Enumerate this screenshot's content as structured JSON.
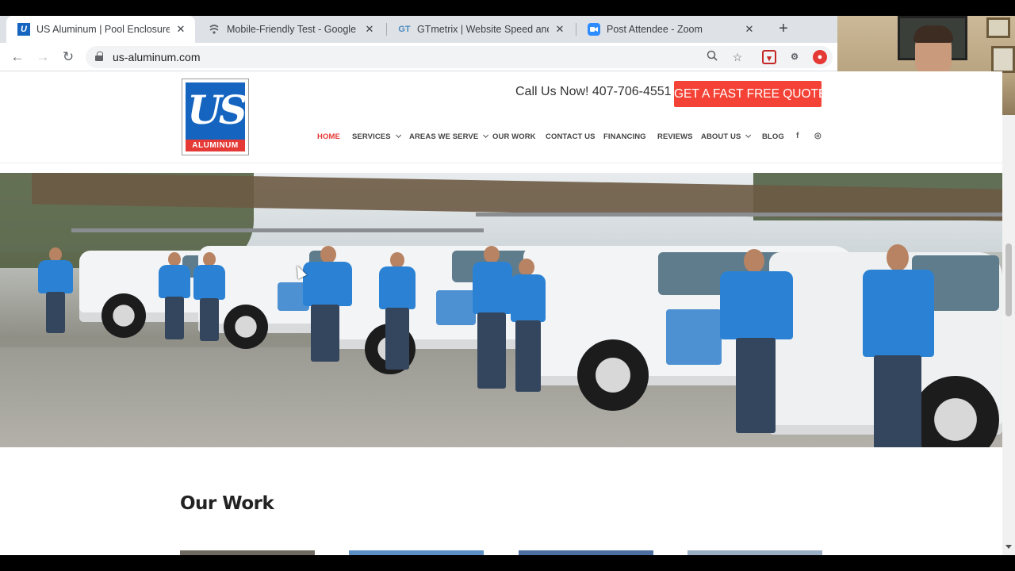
{
  "browser": {
    "tabs": [
      {
        "title": "US Aluminum | Pool Enclosures",
        "icon": "us-aluminum-favicon",
        "active": true
      },
      {
        "title": "Mobile-Friendly Test - Google Se",
        "icon": "google-search-console-icon",
        "active": false
      },
      {
        "title": "GTmetrix | Website Speed and Pe",
        "icon": "gtmetrix-icon",
        "icon_text": "GT",
        "active": false
      },
      {
        "title": "Post Attendee - Zoom",
        "icon": "zoom-icon",
        "active": false
      }
    ],
    "new_tab_glyph": "+",
    "close_glyph": "✕",
    "url": "us-aluminum.com"
  },
  "site": {
    "logo_text": "US",
    "logo_subtext": "ALUMINUM",
    "call_us": "Call Us Now! 407-706-4551",
    "quote_button": "GET A FAST FREE QUOTE",
    "nav": [
      {
        "label": "HOME",
        "active": true,
        "dropdown": false
      },
      {
        "label": "SERVICES",
        "active": false,
        "dropdown": true
      },
      {
        "label": "AREAS WE SERVE",
        "active": false,
        "dropdown": true
      },
      {
        "label": "OUR WORK",
        "active": false,
        "dropdown": false
      },
      {
        "label": "CONTACT US",
        "active": false,
        "dropdown": false
      },
      {
        "label": "FINANCING",
        "active": false,
        "dropdown": false
      },
      {
        "label": "REVIEWS",
        "active": false,
        "dropdown": false
      },
      {
        "label": "ABOUT US",
        "active": false,
        "dropdown": true
      },
      {
        "label": "BLOG",
        "active": false,
        "dropdown": false
      }
    ],
    "social": {
      "facebook": "f",
      "instagram": "◎"
    },
    "section_heading": "Our Work"
  },
  "colors": {
    "accent_red": "#f44336",
    "active_nav": "#e53935",
    "brand_blue": "#1565c0"
  }
}
